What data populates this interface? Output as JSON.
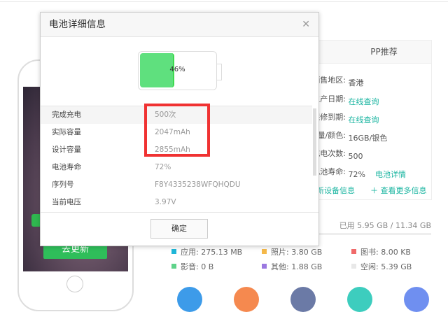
{
  "phone": {
    "update_button": "去更新"
  },
  "pp_panel": {
    "title": "PP推荐",
    "rows": [
      {
        "label": "销售地区:",
        "value": "香港"
      },
      {
        "label": "生产日期:",
        "value": "在线查询",
        "link": true
      },
      {
        "label": "保修到期:",
        "value": "在线查询",
        "link": true
      },
      {
        "label": "容量/颜色:",
        "value": "16GB/银色"
      },
      {
        "label": "充电次数:",
        "value": "500"
      },
      {
        "label": "电池寿命:",
        "value": "72%",
        "extra_link": "电池详情"
      }
    ],
    "refresh": "刷新设备信息",
    "more": "＋ 查看更多信息"
  },
  "storage": {
    "used": "已用 5.95 GB / 11.34 GB",
    "legend": [
      {
        "label": "应用: 275.13 MB",
        "color": "#1fb6d8"
      },
      {
        "label": "照片: 3.80 GB",
        "color": "#f5b94a"
      },
      {
        "label": "图书: 8.00 KB",
        "color": "#f06a6a"
      },
      {
        "label": "影音: 0 B",
        "color": "#5fd38a"
      },
      {
        "label": "其他: 1.88 GB",
        "color": "#9b78e0"
      },
      {
        "label": "空闲: 5.39 GB",
        "color": "#e8e8e8"
      }
    ]
  },
  "modal": {
    "title": "电池详细信息",
    "battery_percent_label": "46%",
    "battery_level": 0.46,
    "rows": [
      {
        "key": "完成充电",
        "value": "500次"
      },
      {
        "key": "实际容量",
        "value": "2047mAh"
      },
      {
        "key": "设计容量",
        "value": "2855mAh"
      },
      {
        "key": "电池寿命",
        "value": "72%"
      },
      {
        "key": "序列号",
        "value": "F8Y4335238WFQHQDU"
      },
      {
        "key": "当前电压",
        "value": "3.97V"
      }
    ],
    "ok_button": "确定"
  },
  "colors": {
    "accent": "#18b4a0",
    "highlight": "#f03232",
    "battery": "#5fe07e"
  }
}
